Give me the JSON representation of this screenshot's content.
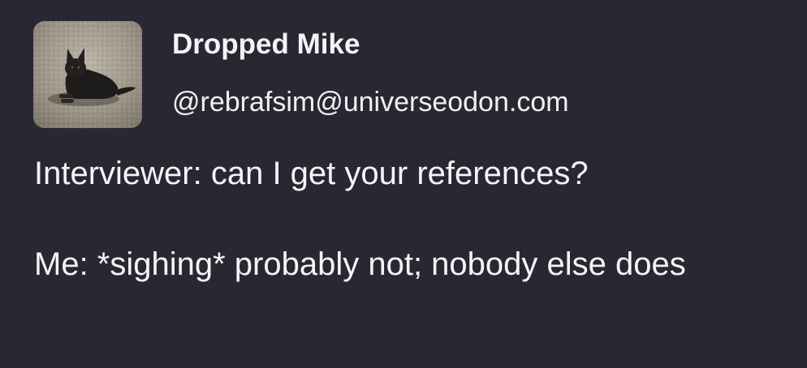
{
  "author": {
    "display_name": "Dropped Mike",
    "handle": "@rebrafsim@universeodon.com",
    "avatar_icon": "cat-photo-avatar"
  },
  "post": {
    "paragraphs": [
      "Interviewer: can I get your references?",
      "Me: *sighing* probably not; nobody else does"
    ]
  },
  "colors": {
    "background": "#282833",
    "text": "#f4f4f6"
  }
}
